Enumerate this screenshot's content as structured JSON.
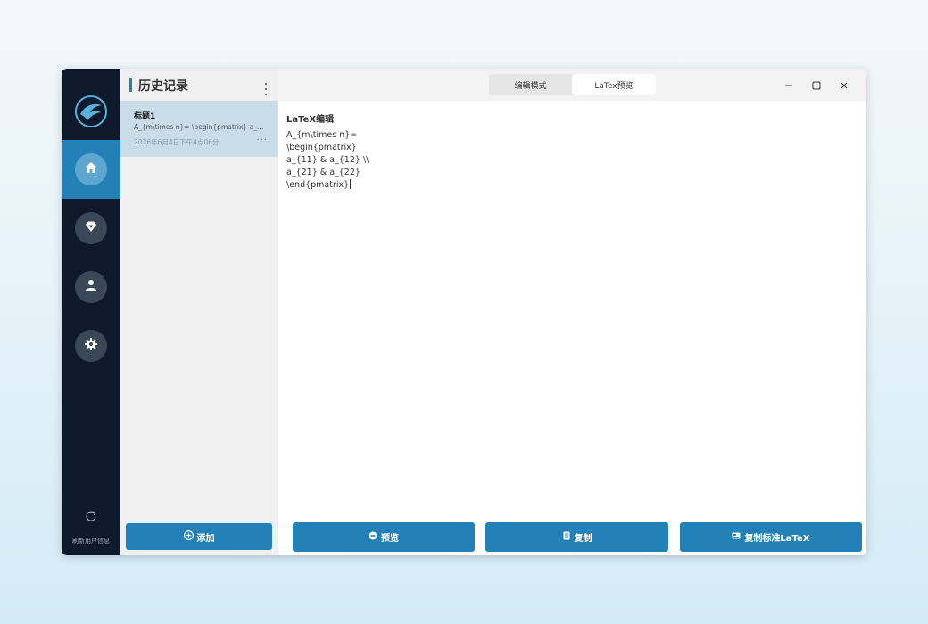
{
  "sidebar": {
    "logo_icon": "eagle-logo-icon",
    "items": [
      {
        "icon": "home-icon",
        "active": true
      },
      {
        "icon": "diamond-icon",
        "active": false
      },
      {
        "icon": "user-icon",
        "active": false
      },
      {
        "icon": "gear-icon",
        "active": false
      }
    ],
    "refresh_label": "刷新用户信息"
  },
  "history": {
    "title": "历史记录",
    "items": [
      {
        "title": "标题1",
        "preview": "A_{m\\times n}= \\begin{pmatrix} a_{11}...",
        "date": "2026年6月4日下午4点06分"
      }
    ],
    "add_label": "添加"
  },
  "tabs": {
    "edit_mode": "编辑模式",
    "latex_preview": "LaTex预览",
    "active": "latex_preview"
  },
  "editor": {
    "label": "LaTeX编辑",
    "lines": [
      "A_{m\\times n}=",
      "\\begin{pmatrix}",
      "a_{11} & a_{12} \\\\",
      "a_{21} & a_{22}",
      "\\end{pmatrix}"
    ]
  },
  "actions": {
    "preview": "预览",
    "copy": "复制",
    "copy_standard": "复制标准LaTeX"
  },
  "colors": {
    "accent": "#2481b8",
    "sidebar_bg": "#0e1a2b"
  }
}
